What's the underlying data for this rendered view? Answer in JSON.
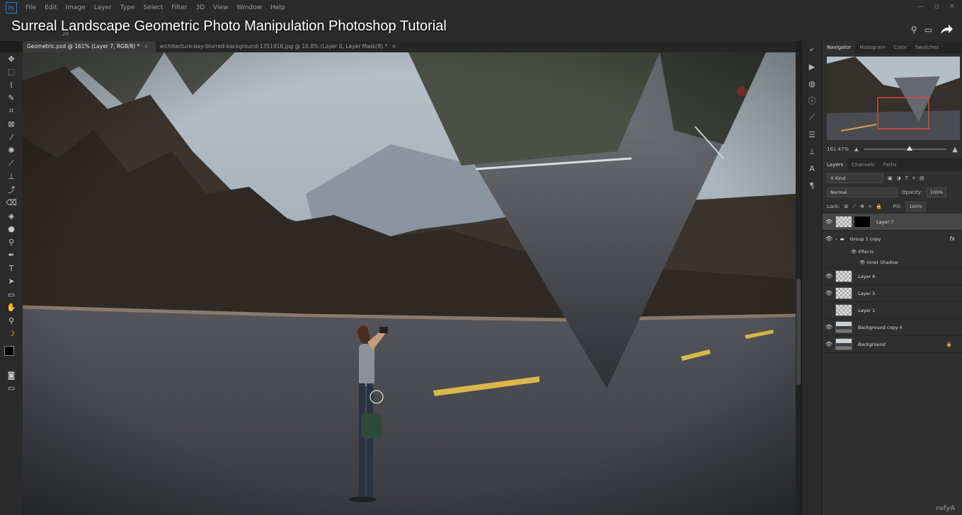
{
  "menu": {
    "app_icon": "Ps",
    "items": [
      "File",
      "Edit",
      "Image",
      "Layer",
      "Type",
      "Select",
      "Filter",
      "3D",
      "View",
      "Window",
      "Help"
    ],
    "window_controls": [
      "—",
      "▫",
      "✕"
    ]
  },
  "tutorial_title": "Surreal Landscape Geometric Photo Manipulation Photoshop Tutorial",
  "options": {
    "brush_size": "20"
  },
  "tabs": [
    {
      "label": "Geometric.psd @ 161% (Layer 7, RGB/8) *",
      "close": "×"
    },
    {
      "label": "architecture-bay-blurred-background-1351916.jpg @ 16.8% (Layer 0, Layer Mask/8) *",
      "close": "×"
    }
  ],
  "tools": [
    {
      "name": "move-tool",
      "glyph": "✥"
    },
    {
      "name": "marquee-tool",
      "glyph": "⬚"
    },
    {
      "name": "lasso-tool",
      "glyph": "⌇"
    },
    {
      "name": "quick-select-tool",
      "glyph": "✎"
    },
    {
      "name": "crop-tool",
      "glyph": "⌗"
    },
    {
      "name": "frame-tool",
      "glyph": "⊠"
    },
    {
      "name": "eyedropper-tool",
      "glyph": "⁄"
    },
    {
      "name": "healing-tool",
      "glyph": "✺"
    },
    {
      "name": "brush-tool",
      "glyph": "⟋"
    },
    {
      "name": "clone-stamp-tool",
      "glyph": "⊥"
    },
    {
      "name": "history-brush-tool",
      "glyph": "⤴"
    },
    {
      "name": "eraser-tool",
      "glyph": "⌫"
    },
    {
      "name": "paint-bucket-tool",
      "glyph": "◈"
    },
    {
      "name": "blur-tool",
      "glyph": "●"
    },
    {
      "name": "dodge-tool",
      "glyph": "⚲"
    },
    {
      "name": "pen-tool",
      "glyph": "✒"
    },
    {
      "name": "type-tool",
      "glyph": "T"
    },
    {
      "name": "path-select-tool",
      "glyph": "➤"
    },
    {
      "name": "rectangle-tool",
      "glyph": "▭"
    },
    {
      "name": "hand-tool",
      "glyph": "✋"
    },
    {
      "name": "zoom-tool",
      "glyph": "⚲"
    },
    {
      "name": "banana-tool",
      "glyph": "☽"
    }
  ],
  "panel": {
    "top_tabs": [
      "Navigator",
      "Histogram",
      "Color",
      "Swatches"
    ],
    "zoom": "161.47%",
    "layer_tabs": [
      "Layers",
      "Channels",
      "Paths"
    ],
    "filter_kind": "Kind",
    "blend_mode": "Normal",
    "opacity_label": "Opacity:",
    "opacity_value": "100%",
    "lock_label": "Lock:",
    "fill_label": "Fill:",
    "fill_value": "100%",
    "layers": [
      {
        "name": "Layer 7",
        "visible": true,
        "selected": true,
        "thumb": "checker",
        "mask": true
      },
      {
        "name": "Group 1 copy",
        "visible": true,
        "group": true,
        "fx": "fx"
      },
      {
        "name": "Layer 6",
        "visible": true,
        "thumb": "checker"
      },
      {
        "name": "Layer 5",
        "visible": true,
        "thumb": "checker"
      },
      {
        "name": "Layer 1",
        "visible": false,
        "thumb": "checker"
      },
      {
        "name": "Background copy 4",
        "visible": true,
        "thumb": "img"
      },
      {
        "name": "Background",
        "visible": true,
        "thumb": "img",
        "locked": true
      }
    ],
    "effects_label": "Effects",
    "inner_shadow_label": "Inner Shadow"
  },
  "watermark": "rafyA",
  "colors": {
    "accent": "#2f7bd6",
    "selected_tool": "#f0c419",
    "nav_frame": "#e0463c"
  }
}
